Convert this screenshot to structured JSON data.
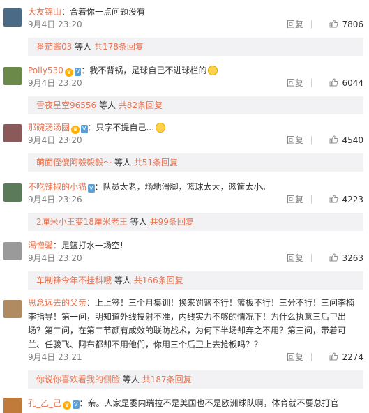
{
  "comments": [
    {
      "username": "大友锦山",
      "content": "合着你一点问题没有",
      "time": "9月4日 23:20",
      "reply_label": "回复",
      "likes": "7806",
      "sub": {
        "user": "番茄酱03",
        "mid": "等人",
        "total": "共178条回复"
      },
      "avatar_color": "#4a6a86"
    },
    {
      "username": "Polly530",
      "content": "我不背锅，是球自己不进球栏的",
      "time": "9月4日 23:20",
      "reply_label": "回复",
      "likes": "6044",
      "sub": {
        "user": "雪夜星空96556",
        "mid": "等人",
        "total": "共82条回复"
      },
      "avatar_color": "#6b8a4a"
    },
    {
      "username": "那碗汤汤圆",
      "content": "只字不提自己...",
      "time": "9月4日 23:20",
      "reply_label": "回复",
      "likes": "4540",
      "sub": {
        "user": "萌面侄傻阿毅毅毅～",
        "mid": "等人",
        "total": "共51条回复"
      },
      "avatar_color": "#8a5a5a"
    },
    {
      "username": "不吃辣椒的小猫",
      "content": "队员太老，场地滑脚，篮球太大，篮筐太小。",
      "time": "9月4日 23:26",
      "reply_label": "回复",
      "likes": "4223",
      "sub": {
        "user": "2厘米小王变18厘米老王",
        "mid": "等人",
        "total": "共99条回复"
      },
      "avatar_color": "#5a7a5a"
    },
    {
      "username": "渴憎馨",
      "content": "足篮打水一场空!",
      "time": "9月4日 23:20",
      "reply_label": "回复",
      "likes": "3263",
      "sub": {
        "user": "车制锋今年不挂科哦",
        "mid": "等人",
        "total": "共166条回复"
      },
      "avatar_color": "#9a9a9a"
    },
    {
      "username": "思念远去的父亲",
      "content_lines": [
        "上上签！三个月集训！换来罚篮不行！篮板不行！三分不行！三问李楠",
        "李指导！第一问，明知道外线投射不准，内线实力不够的情况下！为什么执意三后卫出",
        "场？第二问，在第二节颜有成效的联防战术，为何下半场却弃之不用？第三问，带着可",
        "兰、任骏飞、阿布都却不用他们，你用三个后卫上去抢板吗？？"
      ],
      "time": "9月4日 23:21",
      "reply_label": "回复",
      "likes": "2274",
      "sub": {
        "user": "你说你喜欢看我的侧脸",
        "mid": "等人",
        "total": "共187条回复"
      },
      "avatar_color": "#b08a60"
    },
    {
      "username": "孔_乙_己",
      "content": "亲。人家是委内瑞拉不是美国也不是欧洲球队啊，体育就不要总打官",
      "avatar_color": "#c07a3a"
    }
  ],
  "colors": {
    "link": "#eb7350",
    "meta": "#808080",
    "subbox_bg": "#f2f2f5"
  },
  "icons": {
    "like": "thumbs-up-icon",
    "crown": "crown-icon",
    "vip": "vip-badge-icon",
    "emoji": "emoji-icon"
  }
}
